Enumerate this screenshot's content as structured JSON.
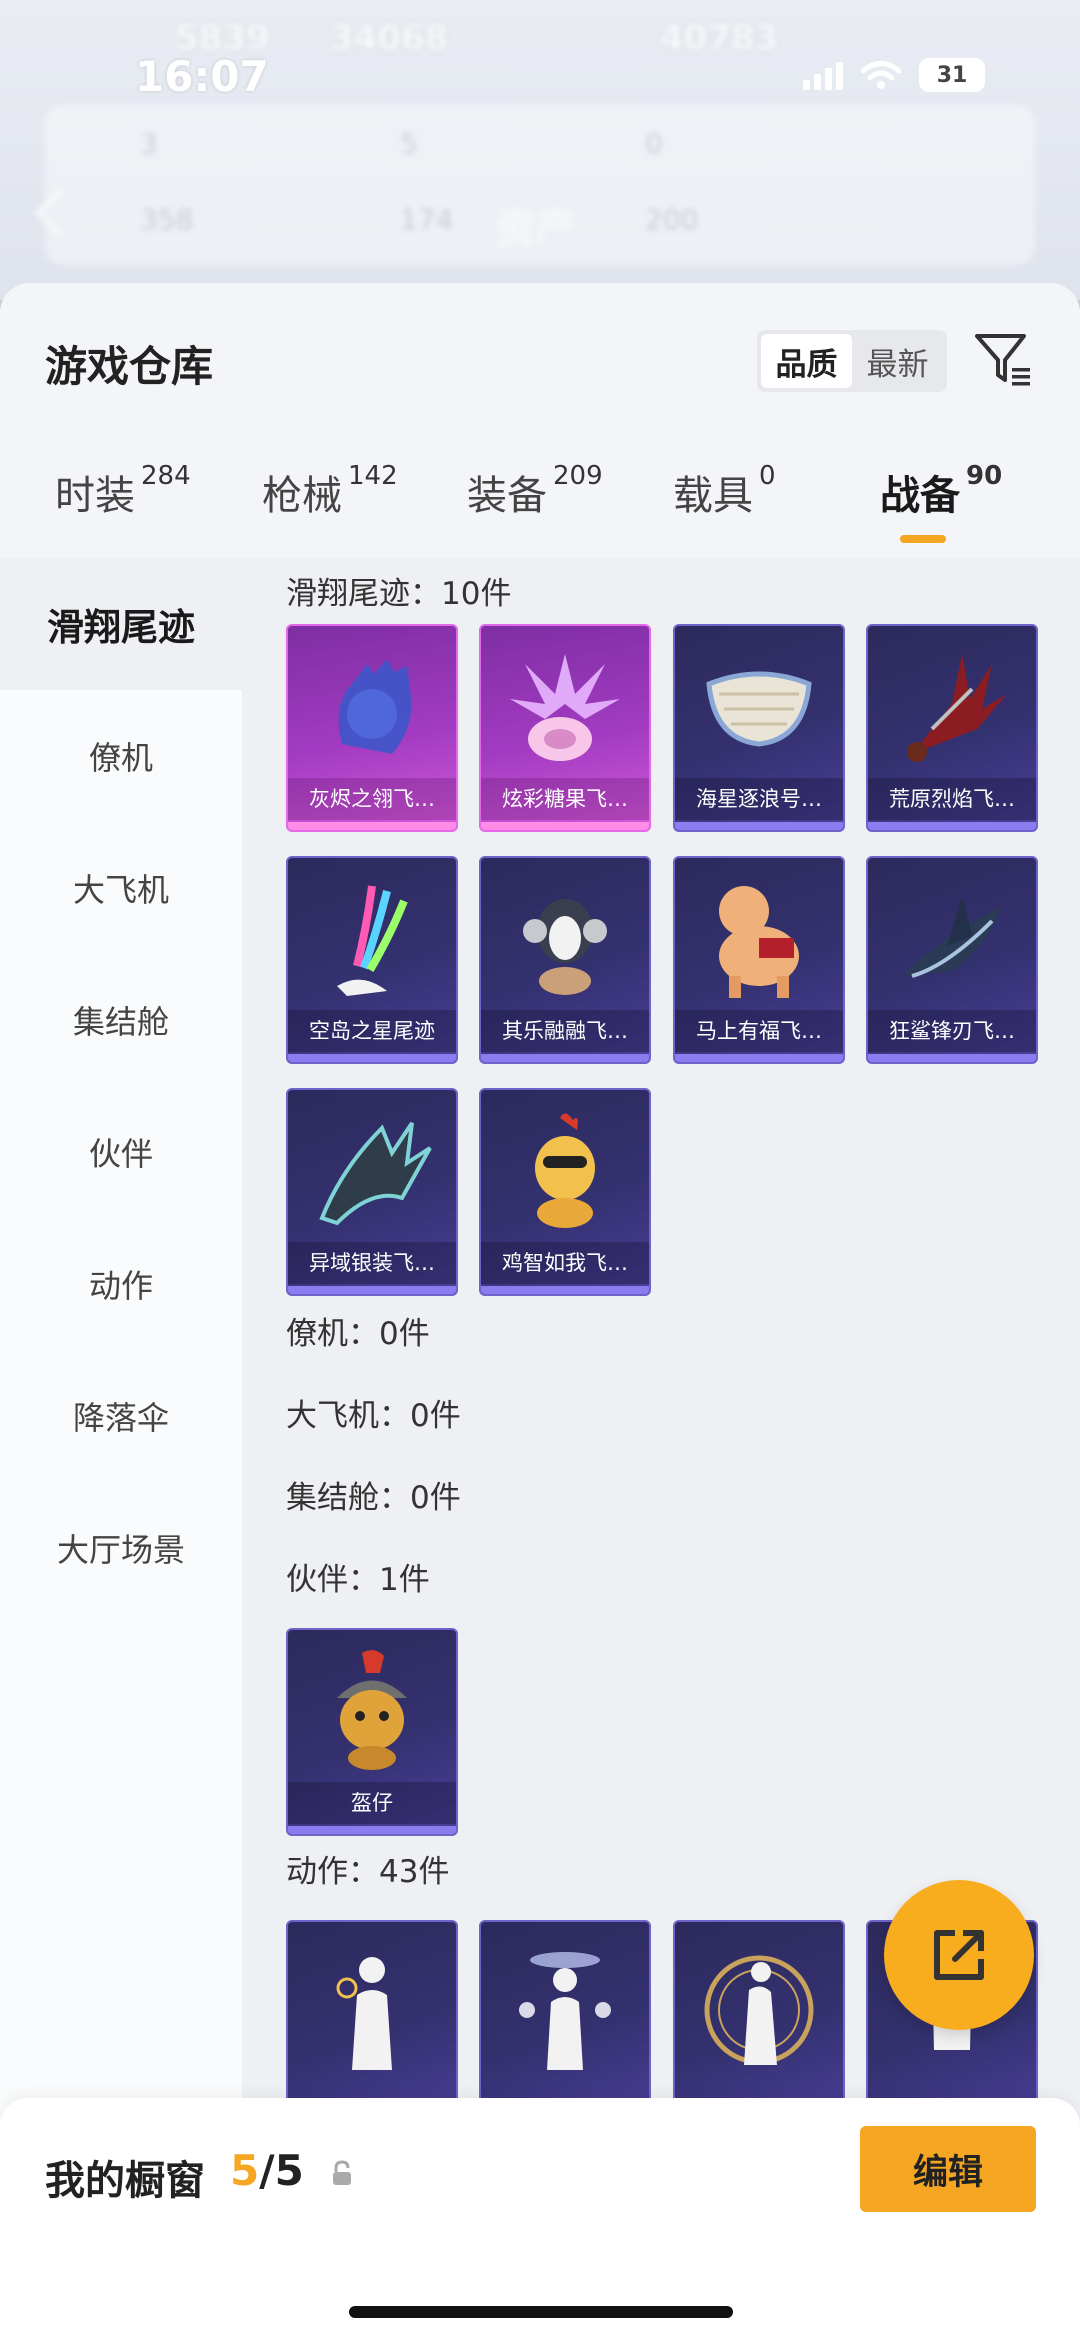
{
  "status_bar": {
    "time": "16:07",
    "battery": "31"
  },
  "background": {
    "top_stats": [
      "5839",
      "34068",
      "40783"
    ],
    "card_values_row1": [
      "3",
      "5",
      "0"
    ],
    "card_values_row2": [
      "358",
      "174",
      "200"
    ],
    "title": "资产"
  },
  "header": {
    "title": "游戏仓库",
    "sort_options": [
      "品质",
      "最新"
    ],
    "sort_active": "品质"
  },
  "categories": [
    {
      "label": "时装",
      "count": "284"
    },
    {
      "label": "枪械",
      "count": "142"
    },
    {
      "label": "装备",
      "count": "209"
    },
    {
      "label": "载具",
      "count": "0"
    },
    {
      "label": "战备",
      "count": "90",
      "active": true
    }
  ],
  "side_nav": [
    "滑翔尾迹",
    "僚机",
    "大飞机",
    "集结舱",
    "伙伴",
    "动作",
    "降落伞",
    "大厅场景"
  ],
  "sections": {
    "glide": {
      "label": "滑翔尾迹：10件"
    },
    "wingman": {
      "label": "僚机：0件"
    },
    "bigplane": {
      "label": "大飞机：0件"
    },
    "capsule": {
      "label": "集结舱：0件"
    },
    "partner": {
      "label": "伙伴：1件"
    },
    "action": {
      "label": "动作：43件"
    }
  },
  "glide_items": [
    {
      "name": "灰烬之翎飞…",
      "rarity": "pink"
    },
    {
      "name": "炫彩糖果飞…",
      "rarity": "pink"
    },
    {
      "name": "海星逐浪号…",
      "rarity": "purple"
    },
    {
      "name": "荒原烈焰飞…",
      "rarity": "purple"
    },
    {
      "name": "空岛之星尾迹",
      "rarity": "purple"
    },
    {
      "name": "其乐融融飞…",
      "rarity": "purple"
    },
    {
      "name": "马上有福飞…",
      "rarity": "purple"
    },
    {
      "name": "狂鲨锋刃飞…",
      "rarity": "purple"
    },
    {
      "name": "异域银装飞…",
      "rarity": "purple"
    },
    {
      "name": "鸡智如我飞…",
      "rarity": "purple"
    }
  ],
  "partner_items": [
    {
      "name": "盔仔",
      "rarity": "purple"
    }
  ],
  "bottom": {
    "title": "我的橱窗",
    "current": "5",
    "total": "/5",
    "edit_label": "编辑"
  },
  "colors": {
    "accent": "#f5a623",
    "card_purple": "#343170",
    "card_pink": "#a23bc1"
  }
}
